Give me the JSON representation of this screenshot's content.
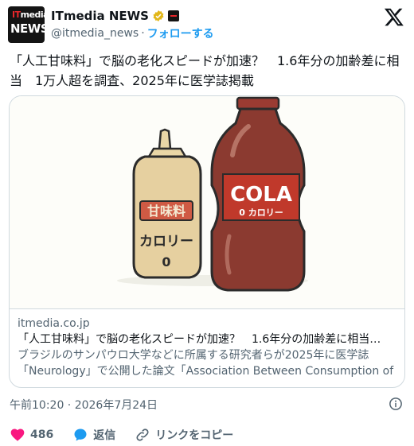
{
  "account": {
    "avatar_top": "ITmedia",
    "avatar_bottom": "NEWS",
    "display_name": "ITmedia NEWS",
    "handle": "@itmedia_news",
    "separator": "·",
    "follow_label": "フォローする"
  },
  "tweet": {
    "text": "「人工甘味料」で脳の老化スピードが加速？　1.6年分の加齢差に相当　1万人超を調査、2025年に医学誌掲載"
  },
  "card": {
    "bottle_small_label_top": "甘味料",
    "bottle_small_label_bottom": "カロリー",
    "bottle_small_label_zero": "0",
    "bottle_big_label": "COLA",
    "bottle_big_sublabel": "0 カロリー",
    "domain": "itmedia.co.jp",
    "title": "「人工甘味料」で脳の老化スピードが加速？　1.6年分の加齢差に相当…",
    "description": "ブラジルのサンパウロ大学などに所属する研究者らが2025年に医学誌「Neurology」で公開した論文「Association Between Consumption of …"
  },
  "meta": {
    "timestamp": "午前10:20 · 2026年7月24日"
  },
  "actions": {
    "like_count": "486",
    "reply_label": "返信",
    "copy_label": "リンクをコピー"
  },
  "colors": {
    "like": "#f91880",
    "reply": "#1d9bf0",
    "accent": "#1d9bf0",
    "verified": "#e2b719"
  }
}
